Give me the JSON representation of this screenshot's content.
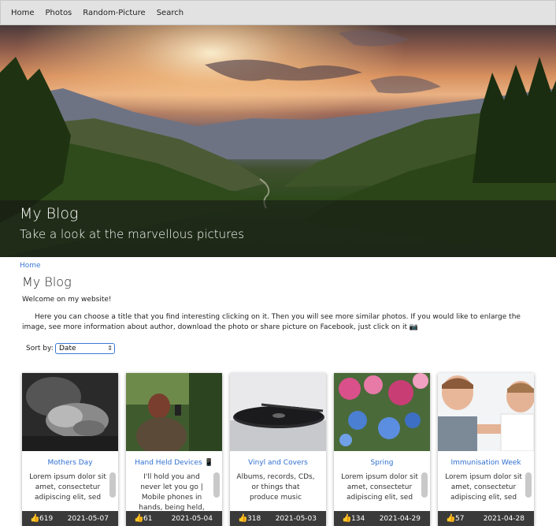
{
  "nav": {
    "items": [
      "Home",
      "Photos",
      "Random-Picture",
      "Search"
    ]
  },
  "hero": {
    "title": "My Blog",
    "subtitle": "Take a look at the marvellous pictures"
  },
  "breadcrumb": "Home",
  "page": {
    "title": "My Blog",
    "welcome": "Welcome on my website!",
    "intro": "Here you can choose a title that you find interesting clicking on it. Then you will see more similar photos. If you would like to enlarge the image, see more information about author, download the photo or share picture on Facebook, just click on it 📷"
  },
  "sort": {
    "label": "Sort by:",
    "value": "Date"
  },
  "cards": [
    {
      "title": "Mothers Day",
      "text": "Lorem ipsum dolor sit amet, consectetur adipiscing elit, sed",
      "likes": "619",
      "date": "2021-05-07"
    },
    {
      "title": "Hand Held Devices 📱",
      "text": "I'll hold you and never let you go | Mobile phones in hands, being held,",
      "likes": "61",
      "date": "2021-05-04"
    },
    {
      "title": "Vinyl and Covers",
      "text": "Albums, records, CDs, or things that produce music",
      "likes": "318",
      "date": "2021-05-03"
    },
    {
      "title": "Spring",
      "text": "Lorem ipsum dolor sit amet, consectetur adipiscing elit, sed",
      "likes": "134",
      "date": "2021-04-29"
    },
    {
      "title": "Immunisation Week",
      "text": "Lorem ipsum dolor sit amet, consectetur adipiscing elit, sed",
      "likes": "57",
      "date": "2021-04-28"
    }
  ],
  "icons": {
    "like": "thumbs-up-icon",
    "sort_caret": "updown-caret-icon"
  },
  "colors": {
    "link": "#2f6fd1",
    "footer": "#3a3a3a",
    "nav_bg": "#e2e2e2"
  }
}
